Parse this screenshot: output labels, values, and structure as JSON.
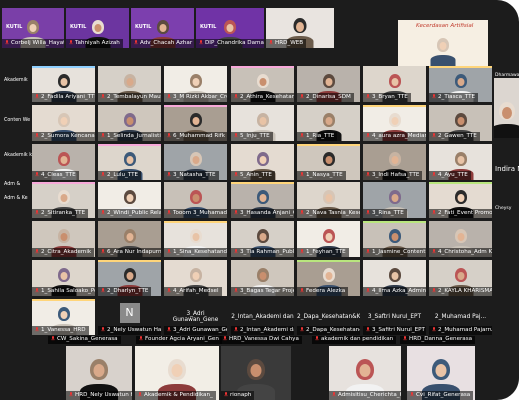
{
  "top_row": [
    {
      "label": "Corbelj Willa_Hayatie A",
      "bg": "#7a3fa8",
      "style": "banner",
      "banner": "KUTIL"
    },
    {
      "label": "Tahniyah Azizah",
      "bg": "#6c35a0",
      "style": "banner",
      "banner": "KUTIL"
    },
    {
      "label": "Adv_Chacah Azhar",
      "bg": "#7c3fae",
      "style": "banner",
      "banner": "KUTIL"
    },
    {
      "label": "DIP_Chandrika Damayant D",
      "bg": "#7033a6",
      "style": "banner",
      "banner": "KUTIL"
    },
    {
      "label": "HRD_WEB",
      "bg": "#e9e4e0",
      "style": "person"
    }
  ],
  "top_right_banner": "Kecerdasan Artifisial",
  "left_sidebar": [
    "Akademik",
    "Conten We",
    "Akademik k",
    "Adm &",
    "Adm & Ke"
  ],
  "right_sidebar": [
    "Dharmawar",
    "Indira Media",
    "Cheysy"
  ],
  "grid": [
    [
      "2_Fadila Ariyani_TTE",
      "2_Tembalayun Mautqo",
      "3_M Rizki Akbar_Crea",
      "2_Athira_Kesehatan",
      "2_Dinarisa_SDM",
      "3_Bryan_TTE",
      "2_Tiasca_TTE"
    ],
    [
      "2_Sumora Kencana",
      "1_Selinda_Jurnalistik",
      "6_Muhammad Rifk Ba",
      "5_Inju_TTE",
      "1_Ria_TTE",
      "4_aura azra_Mediar",
      "2_Gawen_TTE"
    ],
    [
      "4_Cleas_TTE",
      "2_Lulu_TTE",
      "3_Natasha_TTE",
      "5_Anin_TTE",
      "1_Nasya_TTE",
      "3_Indi Hafsa_TTE",
      "4_Ayu_TTE"
    ],
    [
      "2_Sitiranka_TTE",
      "2_Windi_Public Relation",
      "Tooom 3_Muhamad Da",
      "3_Hasanda Anjani_Co",
      "2_Nava Tasnia_Keseha",
      "3_Rina_TTE",
      "2_Fati_Event Promotion"
    ],
    [
      "2_Citra_Akademik",
      "6_Ara Nur Indapurnat",
      "1_Sina_Kesehatanda",
      "3_Tia Rahman_Public",
      "1_Feyhan_TTE",
      "1_Jasmine_Content Wr",
      "4_Christoha_Adm Ke"
    ],
    [
      "1_Sahila Saloako_Pen",
      "2_Dharlyn_TTE",
      "4_Arifah_Medsel",
      "3_Bagas Tegar Project",
      "Federa Alezka",
      "4_Ilma Azka_Adminis",
      "2_KAYLA KHARISMAN"
    ],
    [
      "1_Vanessa_HRD",
      "2_Nely Uswatun Hasa",
      "3_Adri Gunawan_Gen",
      "2_Intan_Akademi dan",
      "2_Dapa_Kesehatan&K",
      "3_Safitri Nurul_EPT",
      "2_Muhamad Pajarrud"
    ]
  ],
  "grid_text_tiles": {
    "6_1": "N",
    "6_2": "3_Adri Gunawan_Gene",
    "6_3": "2_Intan_Akademi dan",
    "6_4": "2_Dapa_Kesehatan&K",
    "6_5": "3_Saftri Nurul_EPT",
    "6_6": "2_Muhamad Paj..."
  },
  "bottom_labels": [
    "CW_Sakina_Generasa",
    "Founder Agcia Aryani_Gen",
    "HRD_Vanessa Dwi Cahya",
    "akademik dan pendidikan",
    "HRD_Danna_Generasa"
  ],
  "bottom_row": [
    {
      "label": "HRD_Nely Uswatun Hasana",
      "bg": "#d8d2cc"
    },
    {
      "label": "Akademik & Pendidikan_",
      "bg": "#f2eee6"
    },
    {
      "label": "rionaph",
      "bg": "#3a3a3a"
    },
    {
      "label": "Admisitisu_Cherichta_Kredi",
      "bg": "#e7e2de"
    },
    {
      "label": "Cvi_Rifat_Generasa",
      "bg": "#e8e0e2"
    }
  ],
  "colors": {
    "screen": "#1c1c1c",
    "caption_bg": "rgba(0,0,0,0.55)",
    "kutil": "#7a3fa8"
  }
}
